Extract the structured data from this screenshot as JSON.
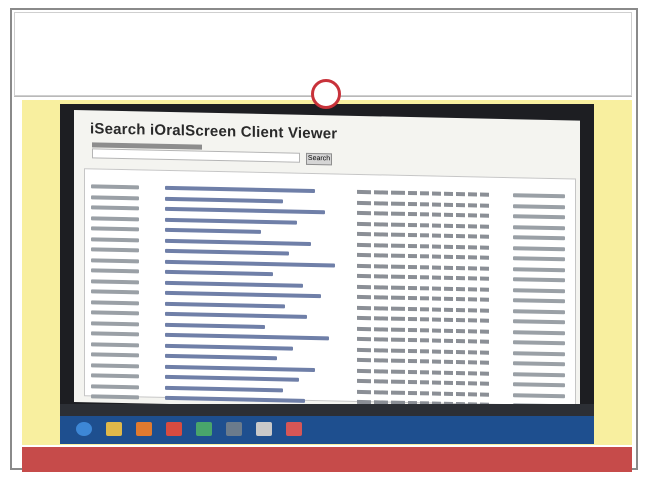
{
  "viewer": {
    "title": "iSearch iOralScreen Client Viewer",
    "search_button": "Search"
  },
  "colors": {
    "frame_background": "#f8ef9f",
    "footer_bar": "#c64b4a",
    "circle": "#c8323a",
    "taskbar": "#1e4f8f"
  },
  "table": {
    "row_count": 22
  },
  "taskbar": {
    "icons": [
      "start-orb-icon",
      "folder-icon",
      "media-player-icon",
      "browser-icon",
      "app-icon",
      "network-icon",
      "app-icon",
      "app-icon"
    ]
  }
}
